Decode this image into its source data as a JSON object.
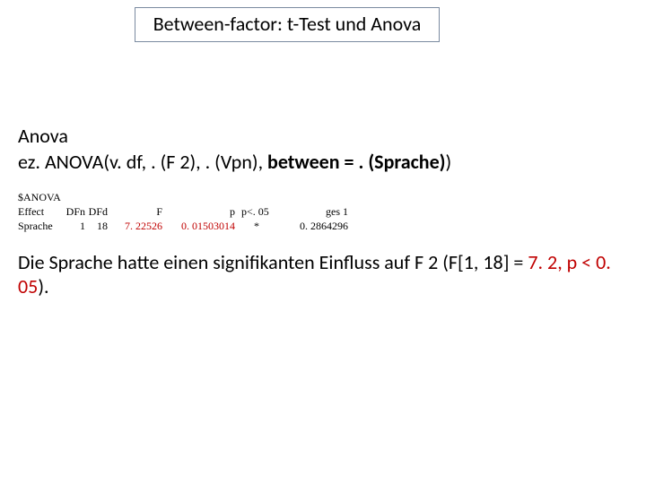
{
  "title": "Between-factor: t-Test und Anova",
  "heading_line1": "Anova",
  "code_prefix": "ez. ANOVA(v. df, . (F 2), . (Vpn), ",
  "code_between": "between = . (Sprache)",
  "code_suffix": ")",
  "anova": {
    "section": "$ANOVA",
    "headers": {
      "effect": "Effect",
      "dfn": "DFn",
      "dfd": "DFd",
      "f": "F",
      "p": "p",
      "p05": "p<. 05",
      "ges": "ges 1"
    },
    "row": {
      "effect": "Sprache",
      "dfn": "1",
      "dfd": "18",
      "f": "7. 22526",
      "p": "0. 01503014",
      "p05": "*",
      "ges": "0. 2864296"
    }
  },
  "conclusion_a": "Die Sprache hatte einen signifikanten Einfluss auf F 2 (F[1, 18] = ",
  "conclusion_red": "7. 2, p < 0. 05",
  "conclusion_b": ")."
}
